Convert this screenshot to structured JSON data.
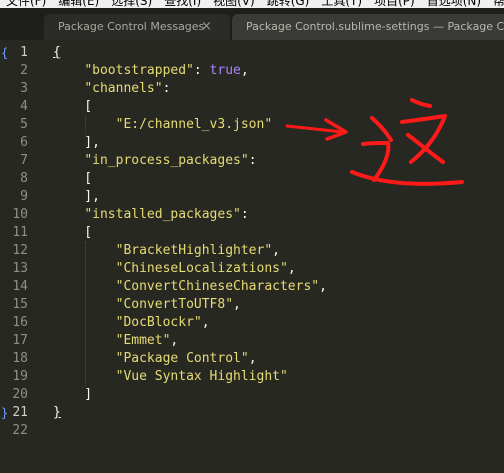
{
  "menubar": {
    "items": [
      "文件(F)",
      "编辑(E)",
      "选择(S)",
      "查找(I)",
      "视图(V)",
      "跳转(G)",
      "工具(T)",
      "项目(P)",
      "首选项(N)",
      "帮助"
    ]
  },
  "tabs": [
    {
      "label": "Package Control Messages",
      "close": "×",
      "active": false
    },
    {
      "label": "Package Control.sublime-settings — Package Control",
      "active": true
    }
  ],
  "editor": {
    "line_numbers": [
      "1",
      "2",
      "3",
      "4",
      "5",
      "6",
      "7",
      "8",
      "9",
      "10",
      "11",
      "12",
      "13",
      "14",
      "15",
      "16",
      "17",
      "18",
      "19",
      "20",
      "21",
      "22"
    ],
    "active_lines": [
      "1",
      "21"
    ],
    "fold_markers": [
      "{",
      "}"
    ],
    "lines": [
      [
        {
          "t": "{",
          "c": "pun ul"
        }
      ],
      [
        {
          "t": "    ",
          "c": "pun"
        },
        {
          "t": "\"bootstrapped\"",
          "c": "str"
        },
        {
          "t": ": ",
          "c": "pun"
        },
        {
          "t": "true",
          "c": "kw"
        },
        {
          "t": ",",
          "c": "pun"
        }
      ],
      [
        {
          "t": "    ",
          "c": "pun"
        },
        {
          "t": "\"channels\"",
          "c": "str"
        },
        {
          "t": ":",
          "c": "pun"
        }
      ],
      [
        {
          "t": "    [",
          "c": "pun"
        }
      ],
      [
        {
          "t": "        ",
          "c": "pun"
        },
        {
          "t": "\"E:/channel_v3.json\"",
          "c": "str"
        }
      ],
      [
        {
          "t": "    ],",
          "c": "pun"
        }
      ],
      [
        {
          "t": "    ",
          "c": "pun"
        },
        {
          "t": "\"in_process_packages\"",
          "c": "str"
        },
        {
          "t": ":",
          "c": "pun"
        }
      ],
      [
        {
          "t": "    [",
          "c": "pun"
        }
      ],
      [
        {
          "t": "    ],",
          "c": "pun"
        }
      ],
      [
        {
          "t": "    ",
          "c": "pun"
        },
        {
          "t": "\"installed_packages\"",
          "c": "str"
        },
        {
          "t": ":",
          "c": "pun"
        }
      ],
      [
        {
          "t": "    [",
          "c": "pun"
        }
      ],
      [
        {
          "t": "        ",
          "c": "pun"
        },
        {
          "t": "\"BracketHighlighter\"",
          "c": "str"
        },
        {
          "t": ",",
          "c": "pun"
        }
      ],
      [
        {
          "t": "        ",
          "c": "pun"
        },
        {
          "t": "\"ChineseLocalizations\"",
          "c": "str"
        },
        {
          "t": ",",
          "c": "pun"
        }
      ],
      [
        {
          "t": "        ",
          "c": "pun"
        },
        {
          "t": "\"ConvertChineseCharacters\"",
          "c": "str"
        },
        {
          "t": ",",
          "c": "pun"
        }
      ],
      [
        {
          "t": "        ",
          "c": "pun"
        },
        {
          "t": "\"ConvertToUTF8\"",
          "c": "str"
        },
        {
          "t": ",",
          "c": "pun"
        }
      ],
      [
        {
          "t": "        ",
          "c": "pun"
        },
        {
          "t": "\"DocBlockr\"",
          "c": "str"
        },
        {
          "t": ",",
          "c": "pun"
        }
      ],
      [
        {
          "t": "        ",
          "c": "pun"
        },
        {
          "t": "\"Emmet\"",
          "c": "str"
        },
        {
          "t": ",",
          "c": "pun"
        }
      ],
      [
        {
          "t": "        ",
          "c": "pun"
        },
        {
          "t": "\"Package Control\"",
          "c": "str"
        },
        {
          "t": ",",
          "c": "pun"
        }
      ],
      [
        {
          "t": "        ",
          "c": "pun"
        },
        {
          "t": "\"Vue Syntax Highlight\"",
          "c": "str"
        }
      ],
      [
        {
          "t": "    ]",
          "c": "pun"
        }
      ],
      [
        {
          "t": "}",
          "c": "pun ul"
        }
      ],
      [
        {
          "t": "",
          "c": "pun"
        }
      ]
    ]
  },
  "annotation": {
    "color": "#ff1a1a",
    "description": "red arrow and handwritten 这 pointing to the channel path"
  }
}
